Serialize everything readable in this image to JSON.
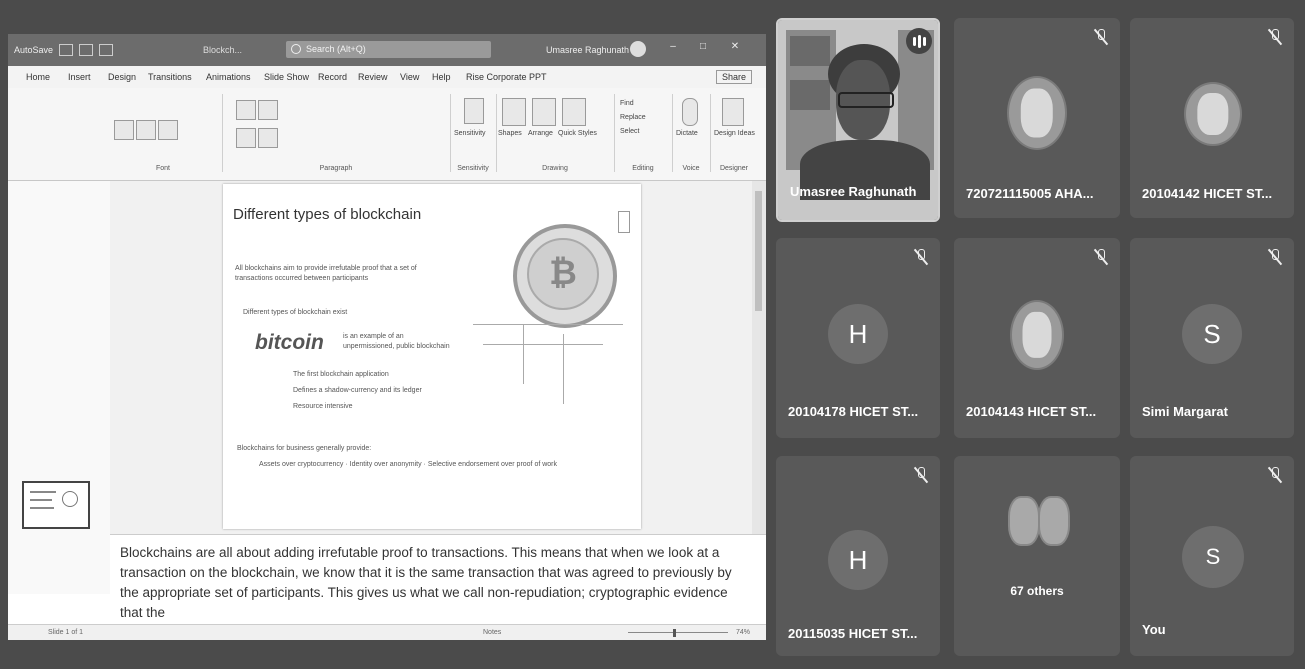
{
  "powerpoint": {
    "autosave_label": "AutoSave",
    "file_name": "Blockch...",
    "search_placeholder": "Search (Alt+Q)",
    "user_name": "Umasree Raghunath",
    "tabs": [
      "Home",
      "Insert",
      "Design",
      "Transitions",
      "Animations",
      "Slide Show",
      "Record",
      "Review",
      "View",
      "Help",
      "Rise Corporate PPT"
    ],
    "share_label": "Share",
    "ribbon_groups": {
      "font": "Font",
      "paragraph": "Paragraph",
      "sensitivity": "Sensitivity",
      "drawing": "Drawing",
      "editing": "Editing",
      "voice": "Voice",
      "designer": "Designer"
    },
    "ribbon_buttons": {
      "sensitivity": "Sensitivity",
      "shapes": "Shapes",
      "arrange": "Arrange",
      "quick_styles": "Quick Styles",
      "find": "Find",
      "replace": "Replace",
      "select": "Select",
      "dictate": "Dictate",
      "design_ideas": "Design Ideas"
    },
    "slide": {
      "title": "Different types of blockchain",
      "bullet1": "All blockchains aim to provide irrefutable proof that a set of transactions occurred between participants",
      "bullet2": "Different types of blockchain exist",
      "bitcoin_logo": "bitcoin",
      "bitcoin_desc": "is an example of an unpermissioned, public blockchain",
      "sub1": "The first blockchain application",
      "sub2": "Defines a shadow-currency and its ledger",
      "sub3": "Resource intensive",
      "bullet3": "Blockchains for business generally provide:",
      "bullet3_sub": "Assets over cryptocurrency · Identity over anonymity · Selective endorsement over proof of work"
    },
    "notes": "Blockchains are all about adding irrefutable proof to transactions. This means that when we look at a transaction on the blockchain, we know that it is the same transaction that was agreed to previously by the appropriate set of participants. This gives us what we call non-repudiation; cryptographic evidence that the",
    "status": {
      "slide_info": "Slide 1 of 1",
      "notes_btn": "Notes",
      "zoom": "74%"
    }
  },
  "participants": [
    {
      "name": "Umasree Raghunath",
      "type": "speaker"
    },
    {
      "name": "720721115005 AHA...",
      "type": "photo",
      "muted": true
    },
    {
      "name": "20104142 HICET ST...",
      "type": "photo",
      "muted": true
    },
    {
      "name": "20104178 HICET ST...",
      "type": "letter",
      "letter": "H",
      "muted": true
    },
    {
      "name": "20104143 HICET ST...",
      "type": "photo",
      "muted": true
    },
    {
      "name": "Simi Margarat",
      "type": "letter",
      "letter": "S",
      "muted": true
    },
    {
      "name": "20115035 HICET ST...",
      "type": "letter",
      "letter": "H",
      "muted": true
    },
    {
      "name": "67 others",
      "type": "others"
    },
    {
      "name": "You",
      "type": "letter",
      "letter": "S",
      "muted": true
    }
  ]
}
